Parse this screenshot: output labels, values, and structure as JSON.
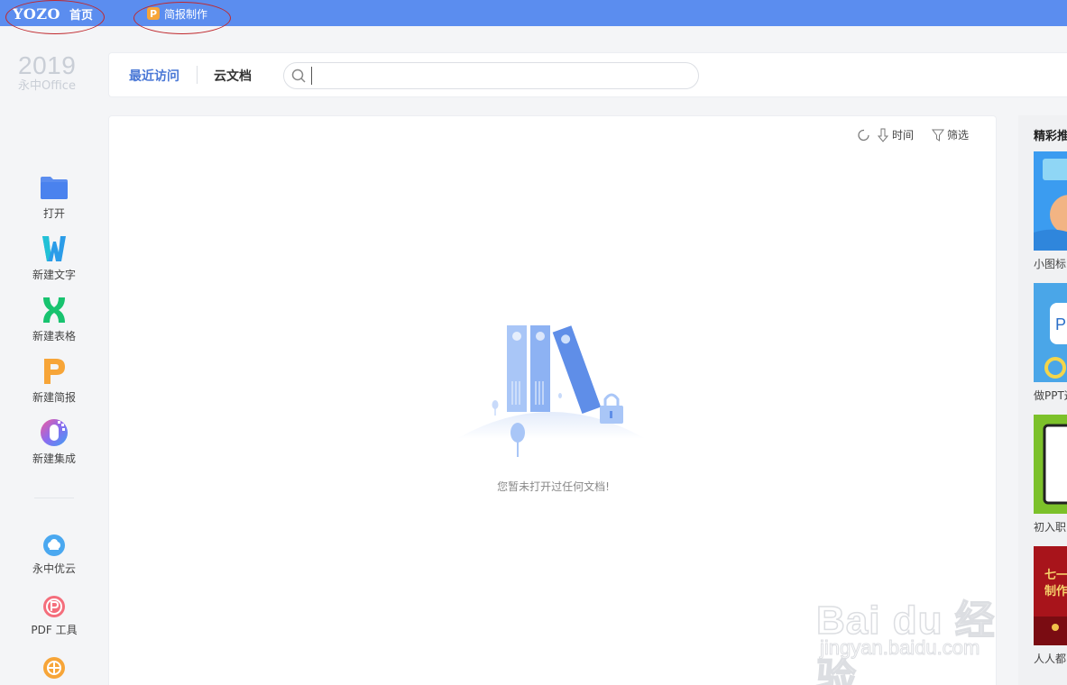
{
  "titlebar": {
    "logo": "YOZO",
    "home": "首页",
    "doc_tab_icon": "P",
    "doc_tab_label": "简报制作"
  },
  "product": {
    "year": "2019",
    "name": "永中Office"
  },
  "sidebar": {
    "items": [
      {
        "label": "打开",
        "icon": "folder-icon"
      },
      {
        "label": "新建文字",
        "icon": "word-w-icon"
      },
      {
        "label": "新建表格",
        "icon": "sheet-x-icon"
      },
      {
        "label": "新建简报",
        "icon": "slides-p-icon"
      },
      {
        "label": "新建集成",
        "icon": "integration-icon"
      },
      {
        "label": "永中优云",
        "icon": "cloud-icon"
      },
      {
        "label": "PDF 工具",
        "icon": "pdf-icon"
      }
    ]
  },
  "tabs": {
    "recent": "最近访问",
    "cloud": "云文档"
  },
  "search": {
    "placeholder": "",
    "value": ""
  },
  "toolbar": {
    "sort_label": "时间",
    "filter_label": "筛选"
  },
  "empty": {
    "message": "您暂未打开过任何文档!"
  },
  "recommend": {
    "title": "精彩推荐",
    "cards": [
      {
        "caption": "小图标"
      },
      {
        "caption": "做PPT这"
      },
      {
        "caption": "初入职"
      },
      {
        "caption": "人人都",
        "text": "七一 制作"
      }
    ]
  },
  "watermark": {
    "main": "Bai du 经验",
    "sub": "jingyan.baidu.com"
  },
  "colors": {
    "titlebar": "#5b8def",
    "accent": "#4a78d6",
    "word": "#2b9ce8",
    "sheet": "#18c36f",
    "slides": "#f7a538"
  }
}
